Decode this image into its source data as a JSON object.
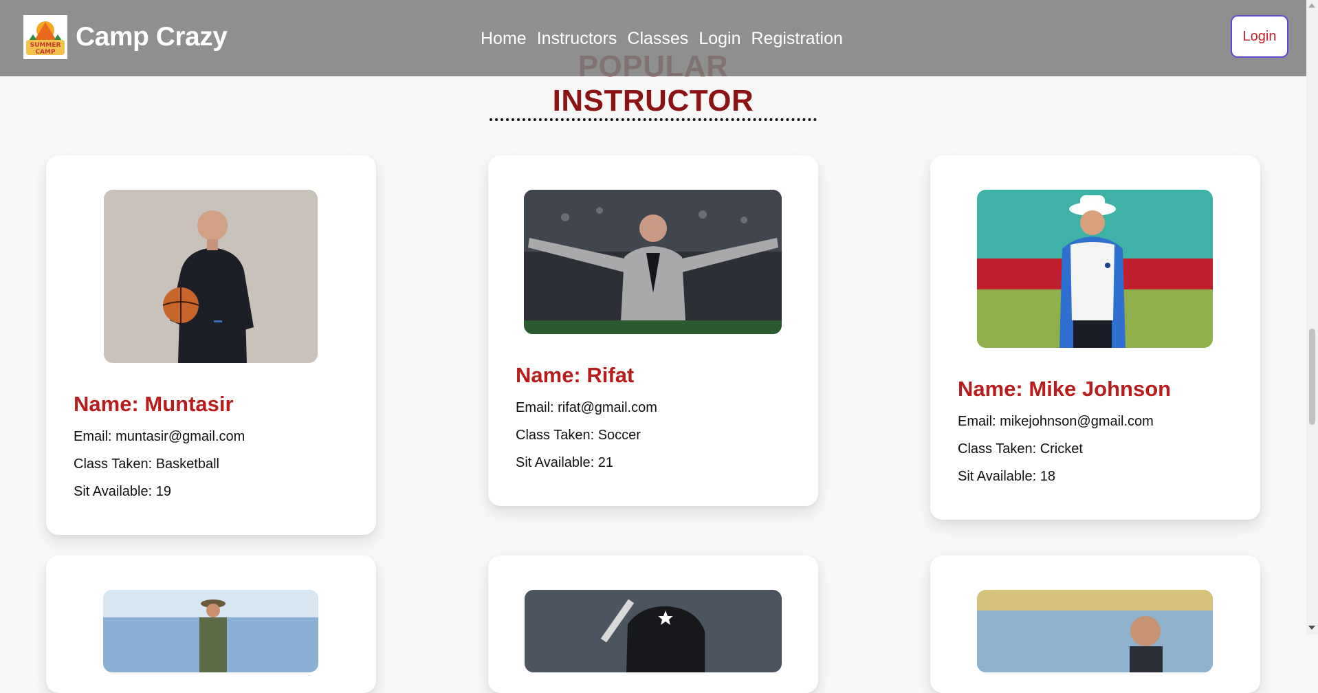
{
  "brand": {
    "logo_text": "SUMMER CAMP",
    "name": "Camp Crazy"
  },
  "nav": {
    "links": [
      "Home",
      "Instructors",
      "Classes",
      "Login",
      "Registration"
    ],
    "login_button": "Login"
  },
  "section": {
    "title": "POPULAR INSTRUCTOR"
  },
  "instructors": [
    {
      "name": "Name: Muntasir",
      "email": "Email: muntasir@gmail.com",
      "class_taken": "Class Taken: Basketball",
      "seats": "Sit Available: 19"
    },
    {
      "name": "Name: Rifat",
      "email": "Email: rifat@gmail.com",
      "class_taken": "Class Taken: Soccer",
      "seats": "Sit Available: 21"
    },
    {
      "name": "Name: Mike Johnson",
      "email": "Email: mikejohnson@gmail.com",
      "class_taken": "Class Taken: Cricket",
      "seats": "Sit Available: 18"
    }
  ],
  "colors": {
    "accent": "#b91c1c",
    "title": "#8b1313",
    "navbar": "#808080",
    "login_border": "#5a4bd0"
  }
}
